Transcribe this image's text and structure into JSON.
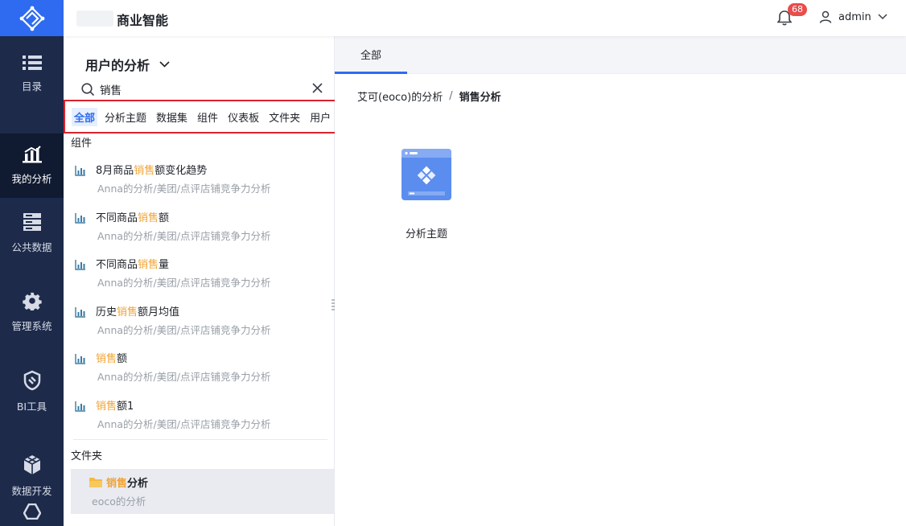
{
  "app": {
    "title": "商业智能"
  },
  "nav_rail": {
    "items": [
      {
        "label": "目录",
        "icon": "list-icon",
        "active": false
      },
      {
        "label": "我的分析",
        "icon": "analysis-chart-icon",
        "active": true
      },
      {
        "label": "公共数据",
        "icon": "database-icon",
        "active": false
      },
      {
        "label": "管理系统",
        "icon": "gear-icon",
        "active": false
      },
      {
        "label": "BI工具",
        "icon": "bi-tool-icon",
        "active": false
      },
      {
        "label": "数据开发",
        "icon": "cube-icon",
        "active": false
      }
    ]
  },
  "header": {
    "notification_count": "68",
    "username": "admin"
  },
  "panel": {
    "title": "用户的分析",
    "search_value": "销售",
    "filter_tabs": [
      {
        "label": "全部",
        "active": true
      },
      {
        "label": "分析主题",
        "active": false
      },
      {
        "label": "数据集",
        "active": false
      },
      {
        "label": "组件",
        "active": false
      },
      {
        "label": "仪表板",
        "active": false
      },
      {
        "label": "文件夹",
        "active": false
      },
      {
        "label": "用户",
        "active": false
      }
    ],
    "components_label": "组件",
    "results": [
      {
        "pre": "8月商品",
        "hl": "销售",
        "post": "额变化趋势",
        "path": "Anna的分析/美团/点评店铺竞争力分析"
      },
      {
        "pre": "不同商品",
        "hl": "销售",
        "post": "额",
        "path": "Anna的分析/美团/点评店铺竞争力分析"
      },
      {
        "pre": "不同商品",
        "hl": "销售",
        "post": "量",
        "path": "Anna的分析/美团/点评店铺竞争力分析"
      },
      {
        "pre": "历史",
        "hl": "销售",
        "post": "额月均值",
        "path": "Anna的分析/美团/点评店铺竞争力分析"
      },
      {
        "pre": "",
        "hl": "销售",
        "post": "额",
        "path": "Anna的分析/美团/点评店铺竞争力分析"
      },
      {
        "pre": "",
        "hl": "销售",
        "post": "额1",
        "path": "Anna的分析/美团/点评店铺竞争力分析"
      }
    ],
    "folders_label": "文件夹",
    "folder_result": {
      "hl": "销售",
      "post": "分析",
      "path": "eoco的分析"
    }
  },
  "main": {
    "tabs": [
      {
        "label": "全部",
        "active": true
      }
    ],
    "breadcrumb": {
      "parent": "艾可(eoco)的分析",
      "separator": "/",
      "current": "销售分析"
    },
    "items": [
      {
        "label": "分析主题",
        "icon": "analysis-theme-icon"
      }
    ]
  },
  "colors": {
    "accent": "#2f6bf1",
    "highlight": "#f0a436",
    "rail_bg": "#1d2a4a",
    "badge": "#e94c4c"
  }
}
